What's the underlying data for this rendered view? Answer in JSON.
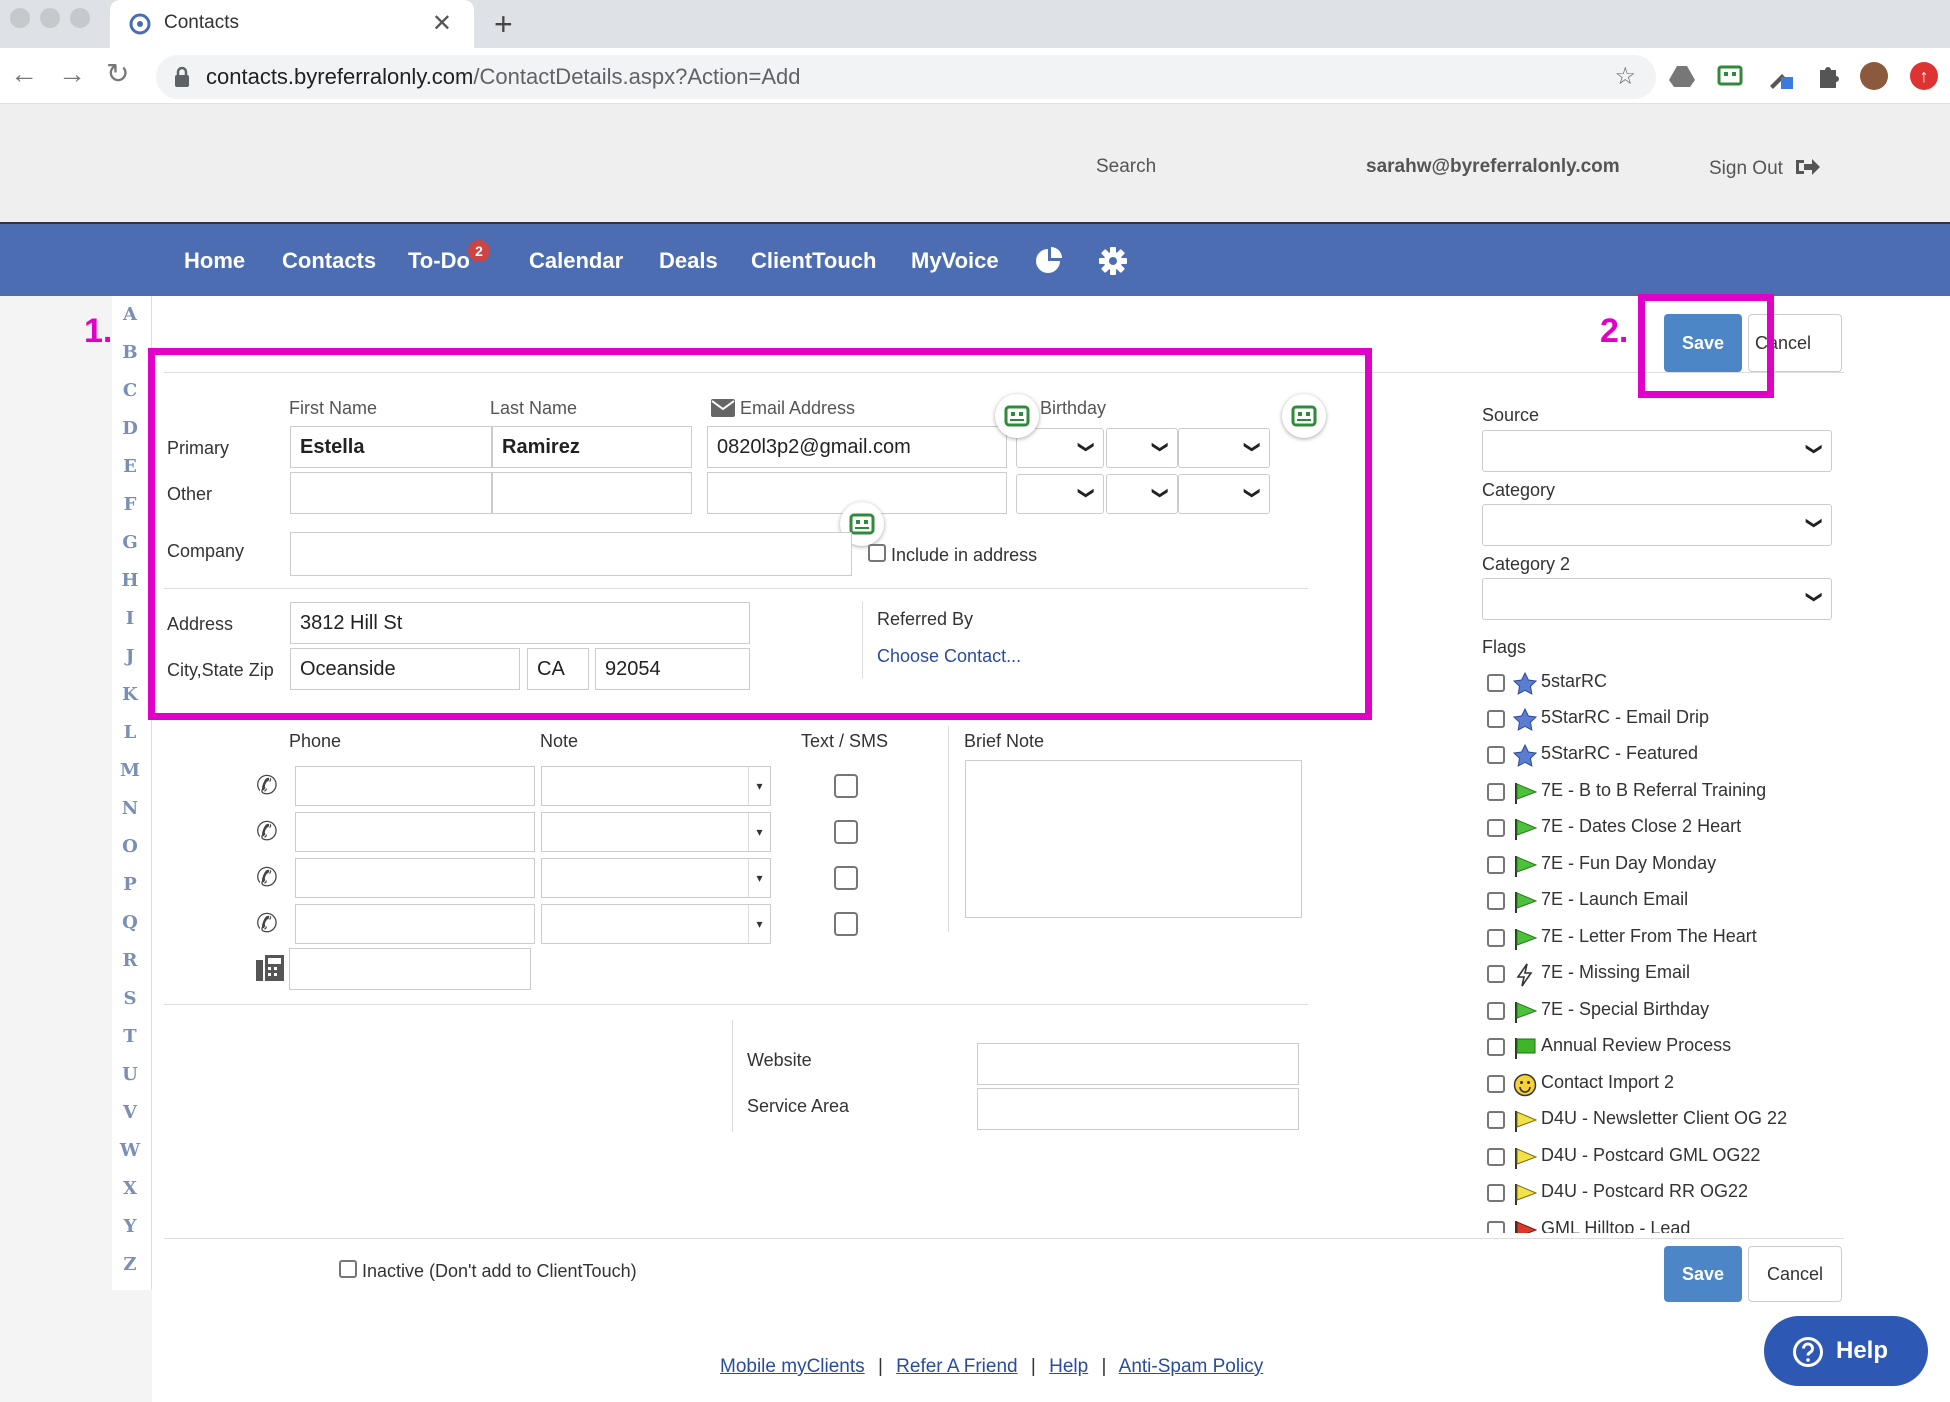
{
  "browser": {
    "tab_title": "Contacts",
    "url_host": "contacts.byreferralonly.com",
    "url_path": "/ContactDetails.aspx?Action=Add"
  },
  "header": {
    "search_label": "Search",
    "user_email": "sarahw@byreferralonly.com",
    "sign_out_label": "Sign Out"
  },
  "nav": {
    "items": [
      "Home",
      "Contacts",
      "To-Do",
      "Calendar",
      "Deals",
      "ClientTouch",
      "MyVoice"
    ],
    "todo_badge": "2"
  },
  "alphabet": [
    "A",
    "B",
    "C",
    "D",
    "E",
    "F",
    "G",
    "H",
    "I",
    "J",
    "K",
    "L",
    "M",
    "N",
    "O",
    "P",
    "Q",
    "R",
    "S",
    "T",
    "U",
    "V",
    "W",
    "X",
    "Y",
    "Z"
  ],
  "form": {
    "col_first_name": "First Name",
    "col_last_name": "Last Name",
    "col_email": "Email Address",
    "col_birthday": "Birthday",
    "row_primary": "Primary",
    "row_other": "Other",
    "primary": {
      "first_name": "Estella",
      "last_name": "Ramirez",
      "email": "0820l3p2@gmail.com"
    },
    "other": {
      "first_name": "",
      "last_name": "",
      "email": ""
    },
    "company_label": "Company",
    "company_value": "",
    "include_in_address_label": "Include in address",
    "address_label": "Address",
    "address_value": "3812 Hill St",
    "city_state_zip_label": "City,State Zip",
    "city": "Oceanside",
    "state": "CA",
    "zip": "92054",
    "referred_by_label": "Referred By",
    "choose_contact_label": "Choose Contact...",
    "phone_label": "Phone",
    "note_label": "Note",
    "text_sms_label": "Text / SMS",
    "brief_note_label": "Brief Note",
    "website_label": "Website",
    "service_area_label": "Service Area",
    "inactive_label": "Inactive (Don't add to ClientTouch)"
  },
  "sidebar": {
    "source_label": "Source",
    "category_label": "Category",
    "category2_label": "Category 2",
    "flags_label": "Flags",
    "flags": [
      {
        "name": "5starRC",
        "icon": "blue-star"
      },
      {
        "name": "5StarRC - Email Drip",
        "icon": "blue-star"
      },
      {
        "name": "5StarRC - Featured",
        "icon": "blue-star"
      },
      {
        "name": "7E - B to B Referral Training",
        "icon": "green-pennant"
      },
      {
        "name": "7E - Dates Close 2 Heart",
        "icon": "green-pennant"
      },
      {
        "name": "7E - Fun Day Monday",
        "icon": "green-pennant"
      },
      {
        "name": "7E - Launch Email",
        "icon": "green-pennant"
      },
      {
        "name": "7E - Letter From The Heart",
        "icon": "green-pennant"
      },
      {
        "name": "7E - Missing Email",
        "icon": "lightning-bolt"
      },
      {
        "name": "7E - Special Birthday",
        "icon": "green-pennant"
      },
      {
        "name": "Annual Review Process",
        "icon": "green-flag"
      },
      {
        "name": "Contact Import 2",
        "icon": "smiley"
      },
      {
        "name": "D4U - Newsletter Client OG 22",
        "icon": "yellow-pennant"
      },
      {
        "name": "D4U - Postcard GML OG22",
        "icon": "yellow-pennant"
      },
      {
        "name": "D4U - Postcard RR OG22",
        "icon": "yellow-pennant"
      },
      {
        "name": "GML Hilltop - Lead",
        "icon": "red-pennant"
      }
    ]
  },
  "actions": {
    "save_label": "Save",
    "cancel_label": "Cancel"
  },
  "annotations": {
    "label_1": "1.",
    "label_2": "2."
  },
  "footer": {
    "links": [
      "Mobile myClients",
      "Refer A Friend",
      "Help",
      "Anti-Spam Policy"
    ],
    "separator": "|"
  },
  "help_button_label": "Help",
  "colors": {
    "nav_bg": "#4d6db3",
    "annotation": "#e000c8",
    "primary_button": "#4d86c6",
    "link": "#2a4c9e"
  }
}
